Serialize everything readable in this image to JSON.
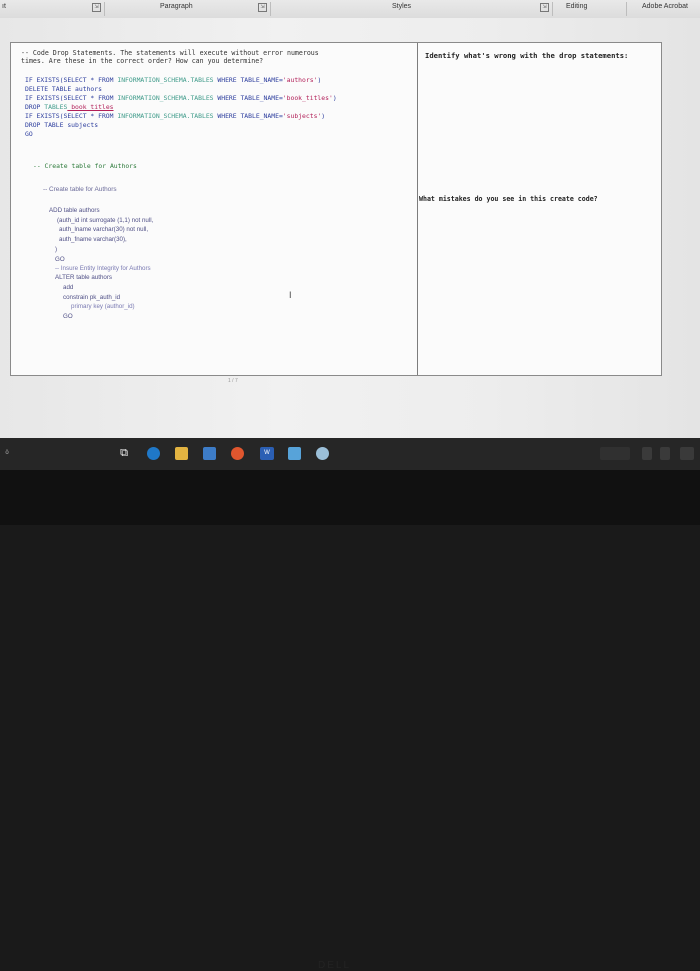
{
  "ribbon": {
    "paragraph_label": "Paragraph",
    "styles_label": "Styles",
    "editing_label": "Editing",
    "app_label": "Adobe Acrobat"
  },
  "document": {
    "intro_line1": "-- Code Drop Statements. The statements will execute without error numerous",
    "intro_line2": "times. Are these in the correct order? How can you determine?",
    "question_right_1": "Identify what's wrong with the drop statements:",
    "question_right_2": "What mistakes do you see in this create code?",
    "drop_code": [
      [
        "IF EXISTS(SELECT * FROM ",
        "INFORMATION_SCHEMA.TABLES",
        " WHERE TABLE_NAME=",
        "'authors'",
        ")"
      ],
      [
        "DELETE TABLE authors"
      ],
      [
        "IF EXISTS(SELECT * FROM ",
        "INFORMATION_SCHEMA.TABLES",
        " WHERE TABLE_NAME=",
        "'book_titles'",
        ")"
      ],
      [
        "DROP ",
        "TABLES",
        " book_titles"
      ],
      [
        "IF EXISTS(SELECT * FROM ",
        "INFORMATION_SCHEMA.TABLES",
        " WHERE TABLE_NAME=",
        "'subjects'",
        ")"
      ],
      [
        "DROP TABLE subjects"
      ],
      [
        "GO"
      ]
    ],
    "comment_create": "-- Create table for Authors",
    "comment_create_hw": "-- Create table for Authors",
    "create_code": [
      "ADD table authors",
      "(auth_id    int surrogate (1,1) not null,",
      "auth_lname   varchar(30) not null,",
      "auth_fname   varchar(30),",
      ")",
      "GO",
      "-- Insure Entity Integrity for Authors",
      "ALTER table authors",
      "add",
      "constrain pk_auth_id",
      "primary key (author_id)",
      "GO"
    ],
    "page_indicator": "1 / 7"
  },
  "colors": {
    "keyword": "#2d3e9e",
    "schema": "#3f9b8a",
    "string": "#b21f58",
    "handwriting": "#6b6b9a"
  }
}
